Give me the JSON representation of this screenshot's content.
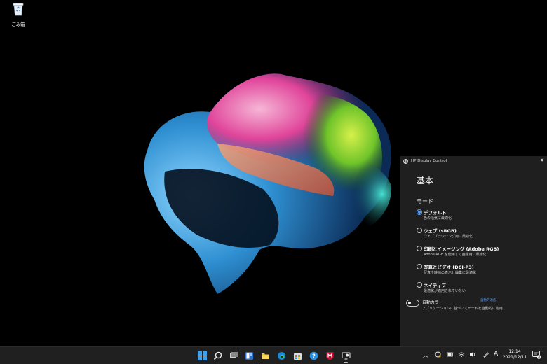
{
  "desktop": {
    "recycle_bin_label": "ごみ箱"
  },
  "panel": {
    "app_title": "HP Display Control",
    "logo_text": "hp",
    "close_label": "X",
    "heading": "基本",
    "section_title": "モード",
    "modes": [
      {
        "label": "デフォルト",
        "desc": "色の活気に最適化",
        "selected": true
      },
      {
        "label": "ウェブ (sRGB)",
        "desc": "ウェブブラウジング用に最適化",
        "selected": false
      },
      {
        "label": "印刷とイメージング (Adobe RGB)",
        "desc": "Adobe RGB を使用して画像用に最適化",
        "selected": false
      },
      {
        "label": "写真とビデオ (DCI-P3)",
        "desc": "写真や映画の表示と編集に最適化",
        "selected": false
      },
      {
        "label": "ネイティブ",
        "desc": "最適化が適用されていない",
        "selected": false
      }
    ],
    "auto_color": {
      "label": "自動カラー",
      "link": "自動的適応",
      "desc": "アプリケーションに基づいてモードを自動的に適用",
      "enabled": false
    }
  },
  "taskbar": {
    "apps": [
      "windows-start-icon",
      "search-icon",
      "task-view-icon",
      "widgets-icon",
      "file-explorer-icon",
      "edge-icon",
      "store-icon",
      "help-icon",
      "mcafee-icon",
      "hp-display-control-icon"
    ],
    "tray": {
      "ime_label": "A",
      "time": "12:14",
      "date": "2021/12/11",
      "notification_count": "3"
    }
  },
  "colors": {
    "panel_bg": "#1f1f1f",
    "accent": "#5b9cf5",
    "taskbar_bg": "#202020"
  }
}
